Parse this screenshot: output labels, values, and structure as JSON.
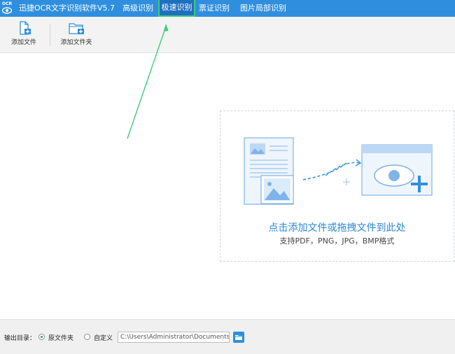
{
  "titlebar": {
    "logo_text": "OCR",
    "app_title": "迅捷OCR文字识别软件V5.7",
    "tabs": [
      {
        "label": "高级识别"
      },
      {
        "label": "极速识别"
      },
      {
        "label": "票证识别"
      },
      {
        "label": "图片局部识别"
      }
    ],
    "active_tab_index": 1
  },
  "toolbar": {
    "add_file_label": "添加文件",
    "add_folder_label": "添加文件夹"
  },
  "dropzone": {
    "title": "点击添加文件或拖拽文件到此处",
    "subtitle": "支持PDF，PNG，JPG，BMP格式"
  },
  "footer": {
    "output_label": "输出目录：",
    "option_source": "原文件夹",
    "option_custom": "自定义",
    "selected_option": "原文件夹",
    "path_value": "C:\\Users\\Administrator\\Documents"
  },
  "colors": {
    "titlebar_bg": "#2f8fde",
    "active_tab_border": "#3ccb7a",
    "accent_text": "#2b87d8",
    "annotation_arrow": "#3ccb7a"
  },
  "icons": {
    "add_file": "add-file-icon",
    "add_folder": "add-folder-icon",
    "browse_folder": "folder-icon"
  }
}
